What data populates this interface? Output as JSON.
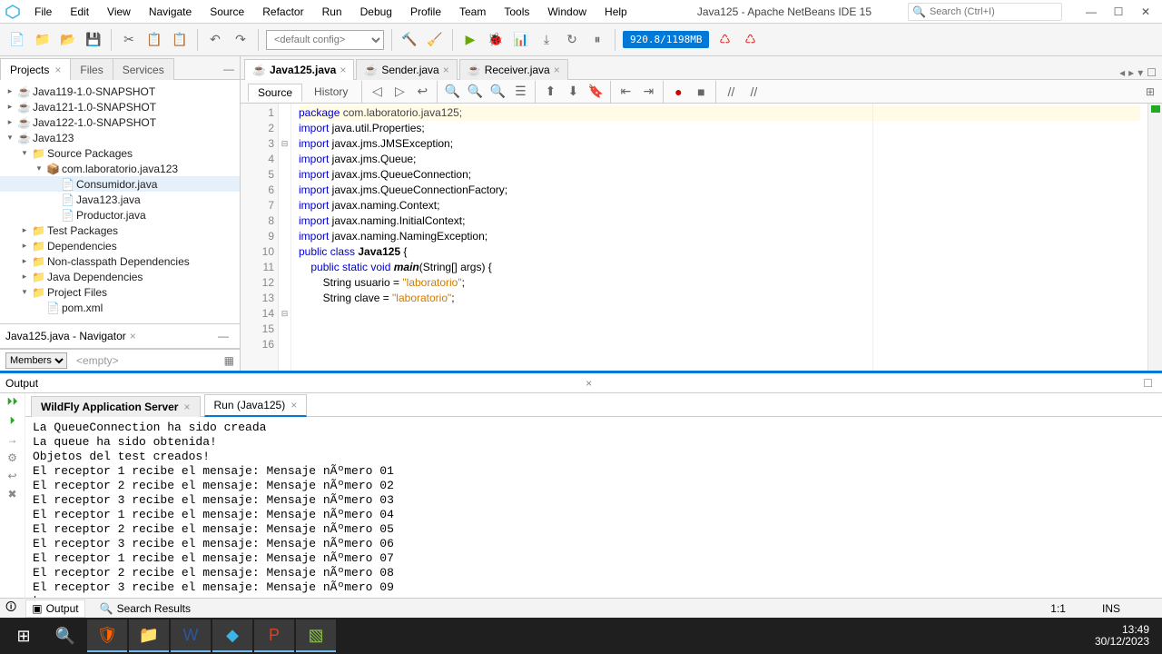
{
  "menu": {
    "items": [
      "File",
      "Edit",
      "View",
      "Navigate",
      "Source",
      "Refactor",
      "Run",
      "Debug",
      "Profile",
      "Team",
      "Tools",
      "Window",
      "Help"
    ],
    "title": "Java125 - Apache NetBeans IDE 15",
    "search_placeholder": "Search (Ctrl+I)"
  },
  "toolbar": {
    "config": "<default config>",
    "heap": "920.8/1198MB"
  },
  "projects": {
    "tabs": [
      "Projects",
      "Files",
      "Services"
    ],
    "nodes": [
      {
        "label": "Java119-1.0-SNAPSHOT",
        "icon": "☕",
        "indent": 0,
        "exp": "▸"
      },
      {
        "label": "Java121-1.0-SNAPSHOT",
        "icon": "☕",
        "indent": 0,
        "exp": "▸"
      },
      {
        "label": "Java122-1.0-SNAPSHOT",
        "icon": "☕",
        "indent": 0,
        "exp": "▸"
      },
      {
        "label": "Java123",
        "icon": "☕",
        "indent": 0,
        "exp": "▾"
      },
      {
        "label": "Source Packages",
        "icon": "📁",
        "indent": 1,
        "exp": "▾"
      },
      {
        "label": "com.laboratorio.java123",
        "icon": "📦",
        "indent": 2,
        "exp": "▾"
      },
      {
        "label": "Consumidor.java",
        "icon": "📄",
        "indent": 3,
        "sel": true
      },
      {
        "label": "Java123.java",
        "icon": "📄",
        "indent": 3
      },
      {
        "label": "Productor.java",
        "icon": "📄",
        "indent": 3
      },
      {
        "label": "Test Packages",
        "icon": "📁",
        "indent": 1,
        "exp": "▸"
      },
      {
        "label": "Dependencies",
        "icon": "📁",
        "indent": 1,
        "exp": "▸"
      },
      {
        "label": "Non-classpath Dependencies",
        "icon": "📁",
        "indent": 1,
        "exp": "▸"
      },
      {
        "label": "Java Dependencies",
        "icon": "📁",
        "indent": 1,
        "exp": "▸"
      },
      {
        "label": "Project Files",
        "icon": "📁",
        "indent": 1,
        "exp": "▾"
      },
      {
        "label": "pom.xml",
        "icon": "📄",
        "indent": 2
      }
    ]
  },
  "navigator": {
    "title": "Java125.java - Navigator",
    "members": "Members",
    "empty": "<empty>"
  },
  "editor": {
    "tabs": [
      {
        "label": "Java125.java",
        "active": true
      },
      {
        "label": "Sender.java"
      },
      {
        "label": "Receiver.java"
      }
    ],
    "source": "Source",
    "history": "History",
    "lines": [
      {
        "n": 1,
        "fold": "",
        "html": "<span class='kw'>package</span> <span class='pkg'>com.laboratorio.java125;</span>",
        "hl": true
      },
      {
        "n": 2,
        "fold": "",
        "html": ""
      },
      {
        "n": 3,
        "fold": "⊟",
        "html": "<span class='kw'>import</span> java.util.Properties;"
      },
      {
        "n": 4,
        "fold": "",
        "html": "<span class='kw'>import</span> javax.jms.JMSException;"
      },
      {
        "n": 5,
        "fold": "",
        "html": "<span class='kw'>import</span> javax.jms.Queue;"
      },
      {
        "n": 6,
        "fold": "",
        "html": "<span class='kw'>import</span> javax.jms.QueueConnection;"
      },
      {
        "n": 7,
        "fold": "",
        "html": "<span class='kw'>import</span> javax.jms.QueueConnectionFactory;"
      },
      {
        "n": 8,
        "fold": "",
        "html": "<span class='kw'>import</span> javax.naming.Context;"
      },
      {
        "n": 9,
        "fold": "",
        "html": "<span class='kw'>import</span> javax.naming.InitialContext;"
      },
      {
        "n": 10,
        "fold": "",
        "html": "<span class='kw'>import</span> javax.naming.NamingException;"
      },
      {
        "n": 11,
        "fold": "",
        "html": ""
      },
      {
        "n": 12,
        "fold": "",
        "html": "<span class='kw'>public class</span> <span class='cls'>Java125</span> {"
      },
      {
        "n": 13,
        "fold": "",
        "html": ""
      },
      {
        "n": 14,
        "fold": "⊟",
        "html": "    <span class='kw'>public static void</span> <span class='cls' style='font-style:italic'>main</span>(String[] args) {"
      },
      {
        "n": 15,
        "fold": "",
        "html": "        String usuario = <span class='str'>\"laboratorio\"</span>;"
      },
      {
        "n": 16,
        "fold": "",
        "html": "        String clave = <span class='str'>\"laboratorio\"</span>;"
      }
    ]
  },
  "output": {
    "title": "Output",
    "tabs": [
      {
        "label": "WildFly Application Server",
        "bold": true
      },
      {
        "label": "Run (Java125)",
        "active": true
      }
    ],
    "lines": [
      "La QueueConnection ha sido creada",
      "La queue ha sido obtenida!",
      "Objetos del test creados!",
      "El receptor 1 recibe el mensaje: Mensaje nÃºmero 01",
      "El receptor 2 recibe el mensaje: Mensaje nÃºmero 02",
      "El receptor 3 recibe el mensaje: Mensaje nÃºmero 03",
      "El receptor 1 recibe el mensaje: Mensaje nÃºmero 04",
      "El receptor 2 recibe el mensaje: Mensaje nÃºmero 05",
      "El receptor 3 recibe el mensaje: Mensaje nÃºmero 06",
      "El receptor 1 recibe el mensaje: Mensaje nÃºmero 07",
      "El receptor 2 recibe el mensaje: Mensaje nÃºmero 08",
      "El receptor 3 recibe el mensaje: Mensaje nÃºmero 09"
    ]
  },
  "status": {
    "output": "Output",
    "search": "Search Results",
    "pos": "1:1",
    "ins": "INS"
  },
  "taskbar": {
    "time": "13:49",
    "date": "30/12/2023"
  }
}
